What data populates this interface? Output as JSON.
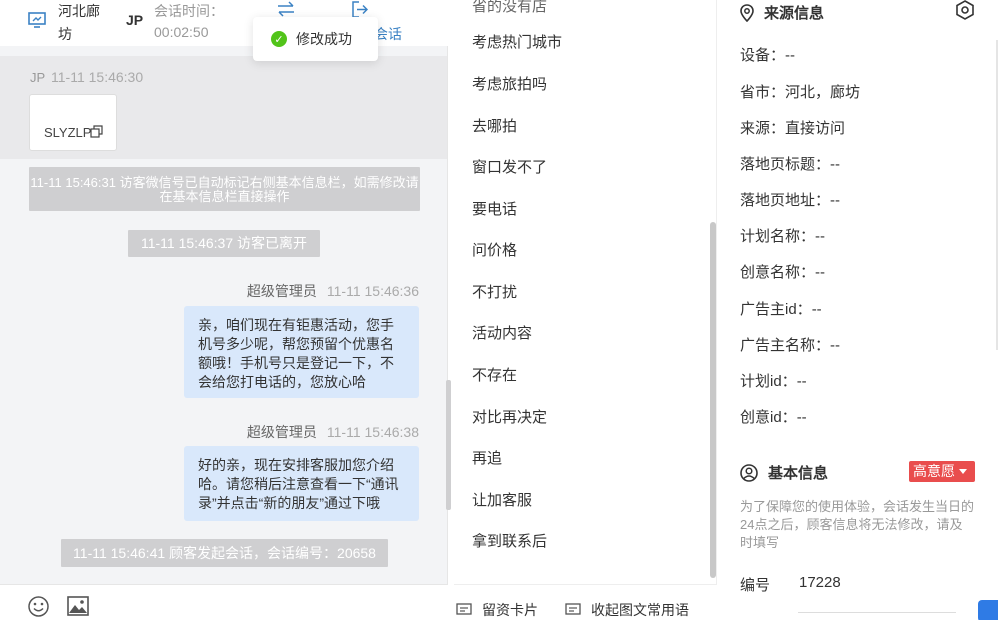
{
  "header": {
    "region": "河北廊坊",
    "visitor_short": "JP",
    "session_time_label": "会话时间：",
    "session_time_value": "00:02:50",
    "end_session_partial": "会话"
  },
  "toast": {
    "text": "修改成功"
  },
  "chat": {
    "visitor_card": {
      "name": "JP",
      "time": "11-11 15:46:30",
      "card_text": "SLYZLP"
    },
    "system_messages": [
      "11-11 15:46:31 访客微信号已自动标记右侧基本信息栏，如需修改请在基本信息栏直接操作",
      "11-11 15:46:37 访客已离开",
      "11-11 15:46:41 顾客发起会话，会话编号：20658"
    ],
    "agent_messages": [
      {
        "name": "超级管理员",
        "time": "11-11 15:46:36",
        "text": "亲，咱们现在有钜惠活动，您手机号多少呢，帮您预留个优惠名额哦！手机号只是登记一下，不会给您打电话的，您放心哈"
      },
      {
        "name": "超级管理员",
        "time": "11-11 15:46:38",
        "text": "好的亲，现在安排客服加您介绍哈。请您稍后注意查看一下“通讯录”并点击“新的朋友”通过下哦"
      }
    ]
  },
  "quick_replies": {
    "items": [
      "考虑热门城市",
      "考虑旅拍吗",
      "去哪拍",
      "窗口发不了",
      "要电话",
      "问价格",
      "不打扰",
      "活动内容",
      "不存在",
      "对比再决定",
      "再追",
      "让加客服",
      "拿到联系后"
    ],
    "footer": {
      "card_label": "留资卡片",
      "collapse_label": "收起图文常用语"
    }
  },
  "info": {
    "source_title": "来源信息",
    "source_fields": [
      {
        "label": "设备：",
        "value": "--"
      },
      {
        "label": "省市：",
        "value": "河北，廊坊"
      },
      {
        "label": "来源：",
        "value": "直接访问"
      },
      {
        "label": "落地页标题：",
        "value": "--"
      },
      {
        "label": "落地页地址：",
        "value": "--"
      },
      {
        "label": "计划名称：",
        "value": "--"
      },
      {
        "label": "创意名称：",
        "value": "--"
      },
      {
        "label": "广告主id：",
        "value": "--"
      },
      {
        "label": "广告主名称：",
        "value": "--"
      },
      {
        "label": "计划id：",
        "value": "--"
      },
      {
        "label": "创意id：",
        "value": "--"
      }
    ],
    "basic_title": "基本信息",
    "intent_badge": "高意愿",
    "notice": "为了保障您的使用体验，会话发生当日的24点之后，顾客信息将无法修改，请及时填写",
    "number_label": "编号",
    "number_value": "17228"
  },
  "colors": {
    "accent": "#3b82c4",
    "bubble": "#d9e8fb",
    "system_msg": "#cfcfd1",
    "badge_red": "#e94d4d",
    "success_green": "#52c41a"
  }
}
